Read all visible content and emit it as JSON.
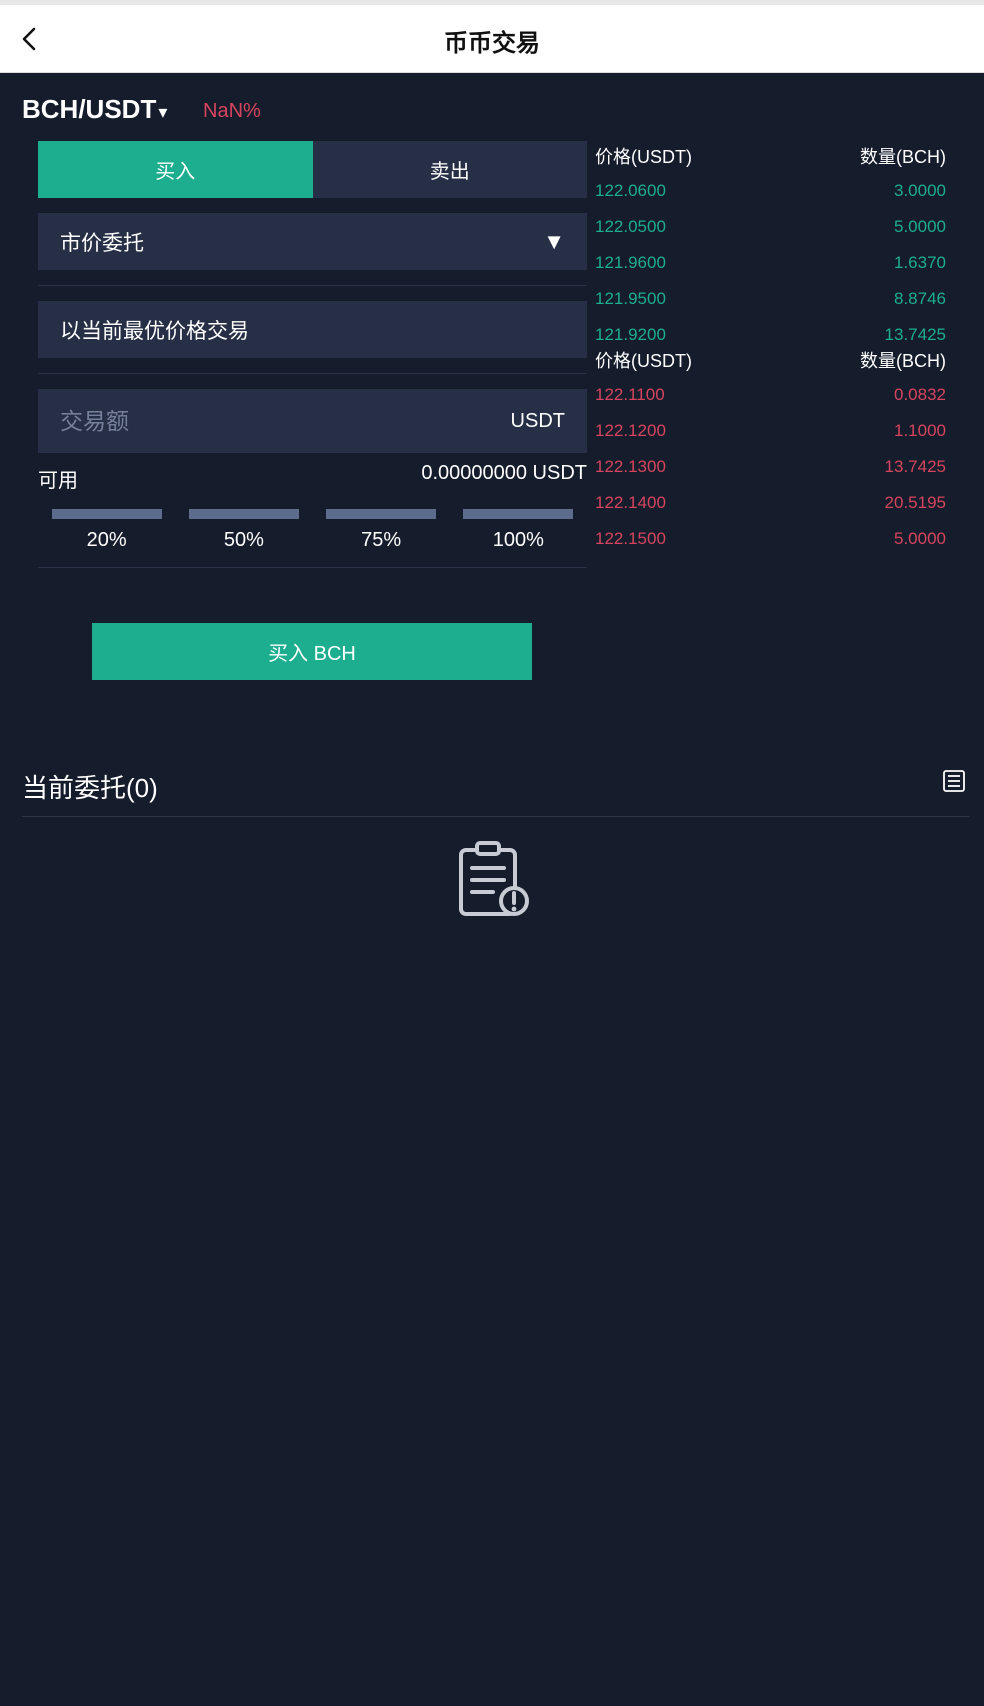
{
  "header": {
    "title": "币币交易",
    "back_icon": "chevron-left-icon"
  },
  "pair": {
    "name": "BCH/USDT",
    "caret": "▾",
    "change": "NaN%"
  },
  "form": {
    "tabs": [
      {
        "label": "买入"
      },
      {
        "label": "卖出"
      }
    ],
    "order_type": {
      "label": "市价委托",
      "arrow": "▼"
    },
    "price_text": "以当前最优价格交易",
    "amount": {
      "placeholder": "交易额",
      "unit": "USDT"
    },
    "available": {
      "label": "可用",
      "value": "0.00000000 USDT"
    },
    "percentages": [
      {
        "label": "20%"
      },
      {
        "label": "50%"
      },
      {
        "label": "75%"
      },
      {
        "label": "100%"
      }
    ],
    "submit_label": "买入 BCH"
  },
  "order_book": {
    "price_header": "价格(USDT)",
    "qty_header": "数量(BCH)",
    "asks": [
      {
        "price": "122.0600",
        "qty": "3.0000"
      },
      {
        "price": "122.0500",
        "qty": "5.0000"
      },
      {
        "price": "121.9600",
        "qty": "1.6370"
      },
      {
        "price": "121.9500",
        "qty": "8.8746"
      },
      {
        "price": "121.9200",
        "qty": "13.7425"
      }
    ],
    "bids": [
      {
        "price": "122.1100",
        "qty": "0.0832"
      },
      {
        "price": "122.1200",
        "qty": "1.1000"
      },
      {
        "price": "122.1300",
        "qty": "13.7425"
      },
      {
        "price": "122.1400",
        "qty": "20.5195"
      },
      {
        "price": "122.1500",
        "qty": "5.0000"
      }
    ]
  },
  "orders": {
    "title": "当前委托(0)",
    "history_icon": "order-list-icon",
    "empty_icon": "clipboard-alert-icon"
  },
  "colors": {
    "buy": "#1dae8f",
    "sell": "#d6455d",
    "background": "#151c2c",
    "panel": "#262f45"
  }
}
